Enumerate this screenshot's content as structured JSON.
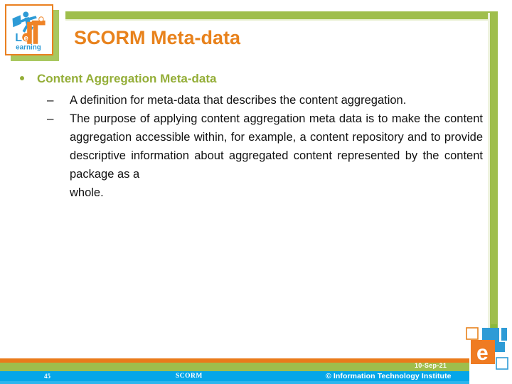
{
  "slide": {
    "title": "SCORM Meta-data",
    "content": {
      "bullets": [
        {
          "level": 1,
          "text": "Content Aggregation Meta-data"
        },
        {
          "level": 2,
          "text": "A definition for meta-data that describes the content aggregation."
        },
        {
          "level": 2,
          "text": "The purpose of applying content aggregation meta data is to make the content aggregation accessible within, for example, a content repository and to provide descriptive information about aggregated content represented by the content package as a",
          "last_line": "whole."
        }
      ]
    }
  },
  "logos": {
    "elearning": {
      "name": "elearning-logo",
      "wordmark_le": "Le",
      "wordmark_earning": "earning"
    },
    "iti": {
      "name": "iti-logo",
      "letter": "e"
    }
  },
  "footer": {
    "page_number": "45",
    "section": "SCORM",
    "date": "10-Sep-21",
    "copyright": "© Information Technology Institute"
  },
  "colors": {
    "title_orange": "#e8821c",
    "accent_green": "#9fbe4c",
    "bullet_green": "#94ae38",
    "footer_blue": "#05a6e8",
    "footer_orange": "#ea7b1b",
    "body_text": "#111111"
  }
}
